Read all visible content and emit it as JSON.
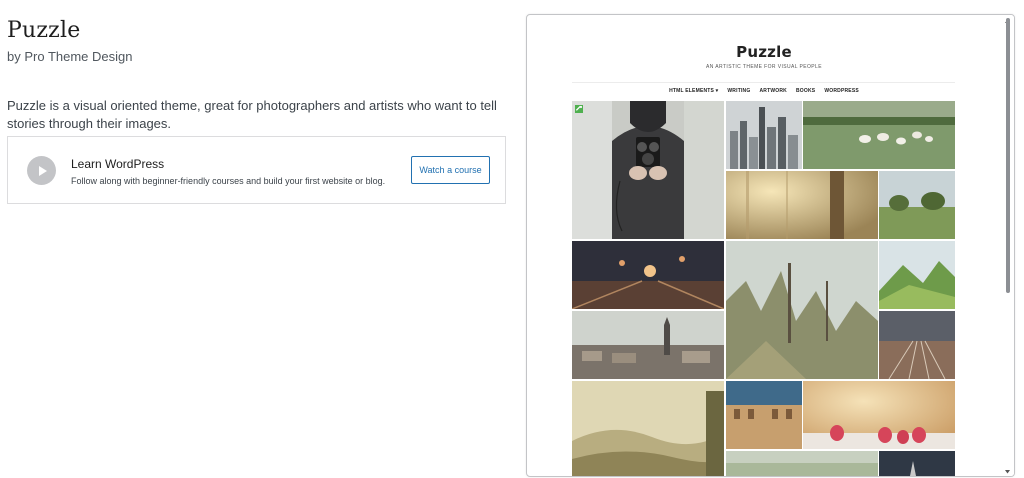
{
  "theme": {
    "title": "Puzzle",
    "author": "by Pro Theme Design",
    "description": "Puzzle is a visual oriented theme, great for photographers and artists who want to tell stories through their images."
  },
  "learn": {
    "title": "Learn WordPress",
    "subtitle": "Follow along with beginner-friendly courses and build your first website or blog.",
    "button": "Watch a course",
    "icon": "play-icon"
  },
  "preview": {
    "site_title": "Puzzle",
    "tagline": "AN ARTISTIC THEME FOR VISUAL PEOPLE",
    "nav": [
      {
        "label": "HTML ELEMENTS ▾"
      },
      {
        "label": "WRITING"
      },
      {
        "label": "ARTWORK"
      },
      {
        "label": "BOOKS"
      },
      {
        "label": "WORDPRESS"
      }
    ],
    "gallery_images": [
      "photographer-with-camera",
      "city-skyline",
      "sheep-in-field",
      "sunlit-forest",
      "meadow-with-trees",
      "train-tracks-at-night",
      "misty-forest-trees",
      "green-mountains",
      "city-rooftops",
      "railway-yard",
      "hazy-hills-landscape",
      "old-building-facade",
      "strawberries-on-table",
      "bottom-left-scene",
      "bottom-right-scene"
    ]
  },
  "colors": {
    "accent": "#2271b1",
    "border": "#dcdcde",
    "featured_badge": "#4fb04f"
  }
}
